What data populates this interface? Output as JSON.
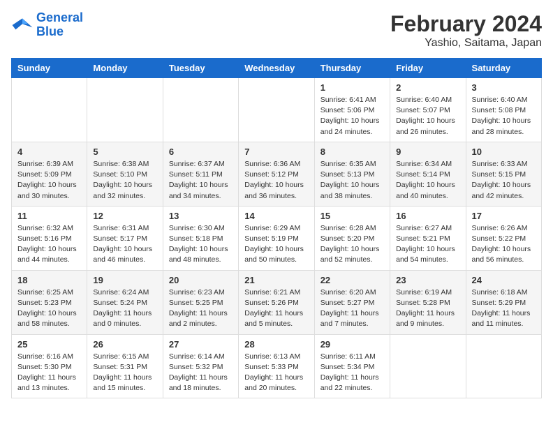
{
  "logo": {
    "line1": "General",
    "line2": "Blue"
  },
  "title": "February 2024",
  "subtitle": "Yashio, Saitama, Japan",
  "days_of_week": [
    "Sunday",
    "Monday",
    "Tuesday",
    "Wednesday",
    "Thursday",
    "Friday",
    "Saturday"
  ],
  "weeks": [
    [
      {
        "num": "",
        "info": ""
      },
      {
        "num": "",
        "info": ""
      },
      {
        "num": "",
        "info": ""
      },
      {
        "num": "",
        "info": ""
      },
      {
        "num": "1",
        "info": "Sunrise: 6:41 AM\nSunset: 5:06 PM\nDaylight: 10 hours\nand 24 minutes."
      },
      {
        "num": "2",
        "info": "Sunrise: 6:40 AM\nSunset: 5:07 PM\nDaylight: 10 hours\nand 26 minutes."
      },
      {
        "num": "3",
        "info": "Sunrise: 6:40 AM\nSunset: 5:08 PM\nDaylight: 10 hours\nand 28 minutes."
      }
    ],
    [
      {
        "num": "4",
        "info": "Sunrise: 6:39 AM\nSunset: 5:09 PM\nDaylight: 10 hours\nand 30 minutes."
      },
      {
        "num": "5",
        "info": "Sunrise: 6:38 AM\nSunset: 5:10 PM\nDaylight: 10 hours\nand 32 minutes."
      },
      {
        "num": "6",
        "info": "Sunrise: 6:37 AM\nSunset: 5:11 PM\nDaylight: 10 hours\nand 34 minutes."
      },
      {
        "num": "7",
        "info": "Sunrise: 6:36 AM\nSunset: 5:12 PM\nDaylight: 10 hours\nand 36 minutes."
      },
      {
        "num": "8",
        "info": "Sunrise: 6:35 AM\nSunset: 5:13 PM\nDaylight: 10 hours\nand 38 minutes."
      },
      {
        "num": "9",
        "info": "Sunrise: 6:34 AM\nSunset: 5:14 PM\nDaylight: 10 hours\nand 40 minutes."
      },
      {
        "num": "10",
        "info": "Sunrise: 6:33 AM\nSunset: 5:15 PM\nDaylight: 10 hours\nand 42 minutes."
      }
    ],
    [
      {
        "num": "11",
        "info": "Sunrise: 6:32 AM\nSunset: 5:16 PM\nDaylight: 10 hours\nand 44 minutes."
      },
      {
        "num": "12",
        "info": "Sunrise: 6:31 AM\nSunset: 5:17 PM\nDaylight: 10 hours\nand 46 minutes."
      },
      {
        "num": "13",
        "info": "Sunrise: 6:30 AM\nSunset: 5:18 PM\nDaylight: 10 hours\nand 48 minutes."
      },
      {
        "num": "14",
        "info": "Sunrise: 6:29 AM\nSunset: 5:19 PM\nDaylight: 10 hours\nand 50 minutes."
      },
      {
        "num": "15",
        "info": "Sunrise: 6:28 AM\nSunset: 5:20 PM\nDaylight: 10 hours\nand 52 minutes."
      },
      {
        "num": "16",
        "info": "Sunrise: 6:27 AM\nSunset: 5:21 PM\nDaylight: 10 hours\nand 54 minutes."
      },
      {
        "num": "17",
        "info": "Sunrise: 6:26 AM\nSunset: 5:22 PM\nDaylight: 10 hours\nand 56 minutes."
      }
    ],
    [
      {
        "num": "18",
        "info": "Sunrise: 6:25 AM\nSunset: 5:23 PM\nDaylight: 10 hours\nand 58 minutes."
      },
      {
        "num": "19",
        "info": "Sunrise: 6:24 AM\nSunset: 5:24 PM\nDaylight: 11 hours\nand 0 minutes."
      },
      {
        "num": "20",
        "info": "Sunrise: 6:23 AM\nSunset: 5:25 PM\nDaylight: 11 hours\nand 2 minutes."
      },
      {
        "num": "21",
        "info": "Sunrise: 6:21 AM\nSunset: 5:26 PM\nDaylight: 11 hours\nand 5 minutes."
      },
      {
        "num": "22",
        "info": "Sunrise: 6:20 AM\nSunset: 5:27 PM\nDaylight: 11 hours\nand 7 minutes."
      },
      {
        "num": "23",
        "info": "Sunrise: 6:19 AM\nSunset: 5:28 PM\nDaylight: 11 hours\nand 9 minutes."
      },
      {
        "num": "24",
        "info": "Sunrise: 6:18 AM\nSunset: 5:29 PM\nDaylight: 11 hours\nand 11 minutes."
      }
    ],
    [
      {
        "num": "25",
        "info": "Sunrise: 6:16 AM\nSunset: 5:30 PM\nDaylight: 11 hours\nand 13 minutes."
      },
      {
        "num": "26",
        "info": "Sunrise: 6:15 AM\nSunset: 5:31 PM\nDaylight: 11 hours\nand 15 minutes."
      },
      {
        "num": "27",
        "info": "Sunrise: 6:14 AM\nSunset: 5:32 PM\nDaylight: 11 hours\nand 18 minutes."
      },
      {
        "num": "28",
        "info": "Sunrise: 6:13 AM\nSunset: 5:33 PM\nDaylight: 11 hours\nand 20 minutes."
      },
      {
        "num": "29",
        "info": "Sunrise: 6:11 AM\nSunset: 5:34 PM\nDaylight: 11 hours\nand 22 minutes."
      },
      {
        "num": "",
        "info": ""
      },
      {
        "num": "",
        "info": ""
      }
    ]
  ]
}
